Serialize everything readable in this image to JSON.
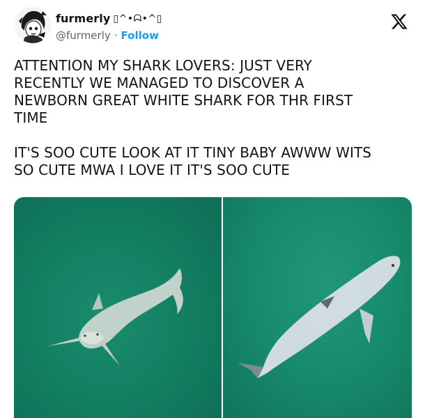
{
  "author": {
    "display_name": "furmerly",
    "name_glyphs": "▯^•ᗣ•^▯",
    "handle": "@furmerly",
    "separator": "·",
    "follow_label": "Follow"
  },
  "platform": {
    "logo_icon": "x-logo-icon"
  },
  "tweet": {
    "paragraphs": [
      "ATTENTION MY SHARK LOVERS: JUST VERY\nRECENTLY WE MANAGED TO DISCOVER A\nNEWBORN GREAT WHITE SHARK FOR THR FIRST\nTIME",
      "IT'S SOO CUTE LOOK AT IT TINY BABY AWWW WITS\nSO CUTE MWA I LOVE IT IT'S SOO CUTE"
    ]
  },
  "media": {
    "photos": [
      {
        "subject": "baby white shark swimming toward camera"
      },
      {
        "subject": "baby white shark swimming diagonally, belly view"
      }
    ],
    "water_color": "#138062"
  }
}
